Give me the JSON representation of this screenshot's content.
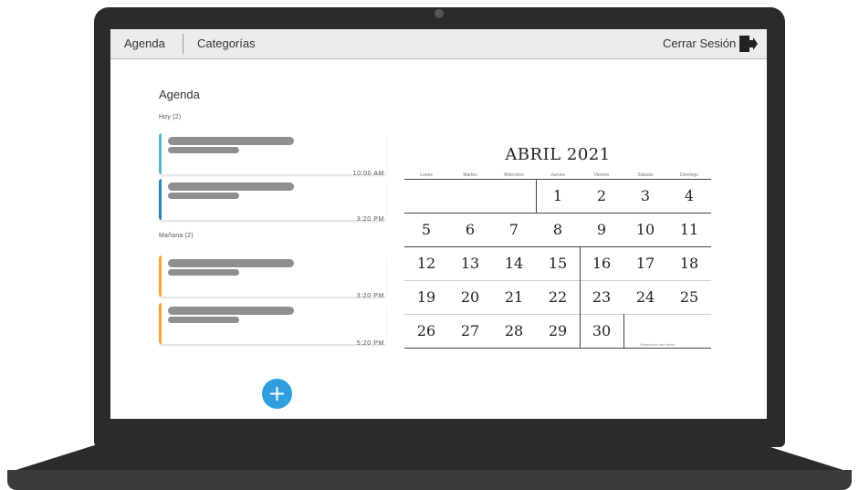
{
  "nav": {
    "agenda_tab": "Agenda",
    "categories_tab": "Categorías",
    "logout_label": "Cerrar Sesión",
    "logout_icon": "logout-door-icon"
  },
  "agenda": {
    "title": "Agenda",
    "today_label": "Hoy (2)",
    "tomorrow_label": "Mañana (2)",
    "today_items": [
      {
        "time": "10:00 AM",
        "color": "#5ab6d0"
      },
      {
        "time": "3:20 PM",
        "color": "#2c7fb8"
      }
    ],
    "tomorrow_items": [
      {
        "time": "3:20 PM",
        "color": "#f2a43a"
      },
      {
        "time": "5:20 PM",
        "color": "#f2a43a"
      }
    ],
    "add_button_icon": "plus-icon",
    "add_button_color": "#2f9ddf"
  },
  "calendar": {
    "title": "ABRIL 2021",
    "weekdays": [
      "Lunes",
      "Martes",
      "Miércoles",
      "Jueves",
      "Viernes",
      "Sábado",
      "Domingo"
    ],
    "weeks": [
      [
        "",
        "",
        "",
        "1",
        "2",
        "3",
        "4"
      ],
      [
        "5",
        "6",
        "7",
        "8",
        "9",
        "10",
        "11"
      ],
      [
        "12",
        "13",
        "14",
        "15",
        "16",
        "17",
        "18"
      ],
      [
        "19",
        "20",
        "21",
        "22",
        "23",
        "24",
        "25"
      ],
      [
        "26",
        "27",
        "28",
        "29",
        "30",
        "",
        ""
      ]
    ],
    "footer_note": "Seleccione una fecha"
  }
}
